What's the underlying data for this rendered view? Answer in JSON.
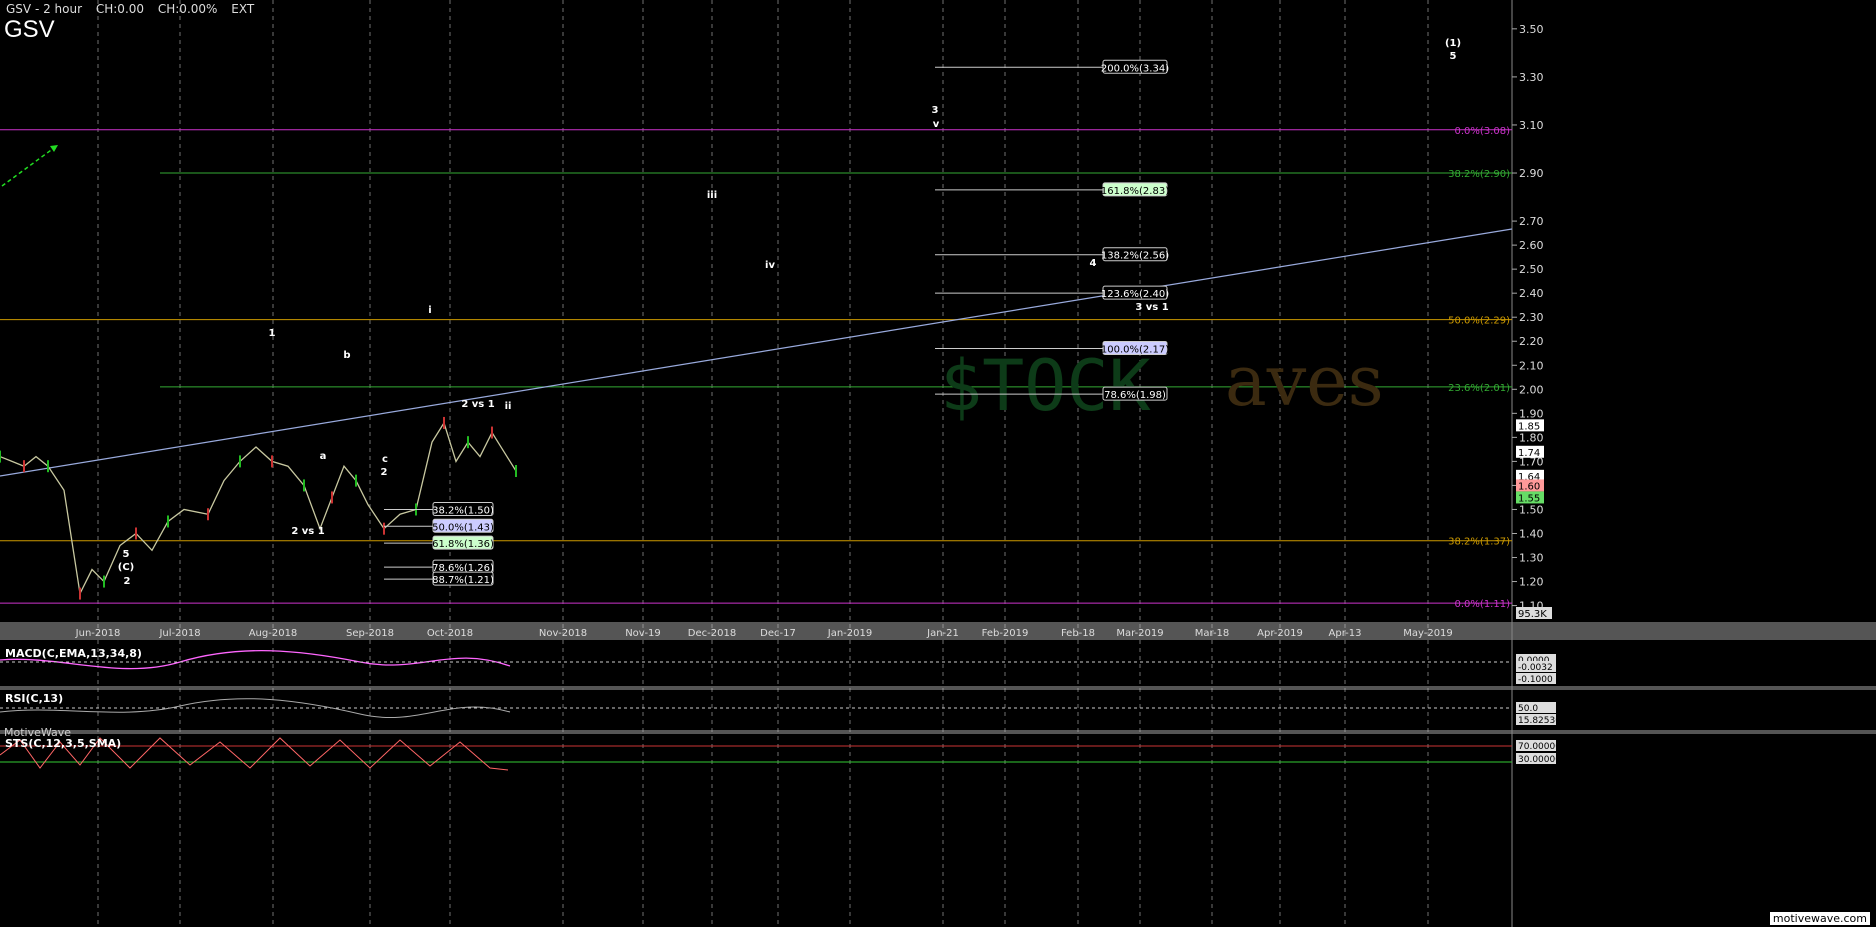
{
  "header": {
    "title": "GSV - 2 hour",
    "ch": "CH:0.00",
    "chp": "CH:0.00%",
    "ext": "EXT",
    "symbol": "GSV"
  },
  "watermark": "MotiveWave",
  "watermark_bottom": "motivewave.com",
  "brand_text": "$TOCK",
  "brand_text2": "aves",
  "chart_data": [
    {
      "type": "line",
      "title": "GSV - 2 hour",
      "ylim": [
        1.04,
        3.62
      ],
      "yticks": [
        3.5,
        3.3,
        3.1,
        2.9,
        2.7,
        2.6,
        2.5,
        2.4,
        2.3,
        2.2,
        2.1,
        2.0,
        1.9,
        1.8,
        1.7,
        1.6,
        1.5,
        1.4,
        1.3,
        1.2,
        1.1
      ],
      "xticks": [
        "Jun-2018",
        "Jul-2018",
        "Aug-2018",
        "Sep-2018",
        "Oct-2018",
        "Nov-2018",
        "Nov-19",
        "Dec-2018",
        "Dec-17",
        "Jan-2019",
        "Jan-21",
        "Feb-2019",
        "Feb-18",
        "Mar-2019",
        "Mar-18",
        "Apr-2019",
        "Apr-13",
        "May-2019"
      ],
      "price_path": [
        [
          0,
          1.72
        ],
        [
          0.15,
          1.7
        ],
        [
          0.3,
          1.68
        ],
        [
          0.45,
          1.72
        ],
        [
          0.6,
          1.68
        ],
        [
          0.8,
          1.58
        ],
        [
          1.0,
          1.15
        ],
        [
          1.15,
          1.25
        ],
        [
          1.3,
          1.2
        ],
        [
          1.5,
          1.35
        ],
        [
          1.7,
          1.4
        ],
        [
          1.9,
          1.33
        ],
        [
          2.1,
          1.45
        ],
        [
          2.3,
          1.5
        ],
        [
          2.6,
          1.48
        ],
        [
          2.8,
          1.62
        ],
        [
          3.0,
          1.7
        ],
        [
          3.2,
          1.76
        ],
        [
          3.4,
          1.7
        ],
        [
          3.6,
          1.68
        ],
        [
          3.8,
          1.6
        ],
        [
          4.0,
          1.42
        ],
        [
          4.15,
          1.55
        ],
        [
          4.3,
          1.68
        ],
        [
          4.45,
          1.62
        ],
        [
          4.6,
          1.52
        ],
        [
          4.8,
          1.42
        ],
        [
          5.0,
          1.48
        ],
        [
          5.2,
          1.5
        ],
        [
          5.4,
          1.78
        ],
        [
          5.55,
          1.86
        ],
        [
          5.7,
          1.7
        ],
        [
          5.85,
          1.78
        ],
        [
          6.0,
          1.72
        ],
        [
          6.15,
          1.82
        ],
        [
          6.3,
          1.74
        ],
        [
          6.45,
          1.66
        ]
      ],
      "fib_levels_up": [
        {
          "label": "200.0%(3.34)",
          "value": 3.34
        },
        {
          "label": "161.8%(2.83)",
          "value": 2.83,
          "color": "#ccffcc"
        },
        {
          "label": "138.2%(2.56)",
          "value": 2.56
        },
        {
          "label": "123.6%(2.40)",
          "value": 2.4
        },
        {
          "label": "100.0%(2.17)",
          "value": 2.17,
          "color": "#ccccff"
        },
        {
          "label": "78.6%(1.98)",
          "value": 1.98
        }
      ],
      "fib_levels_down": [
        {
          "label": "38.2%(1.50)",
          "value": 1.5
        },
        {
          "label": "50.0%(1.43)",
          "value": 1.43,
          "color": "#ccccff"
        },
        {
          "label": "61.8%(1.36)",
          "value": 1.36,
          "color": "#ccffcc"
        },
        {
          "label": "78.6%(1.26)",
          "value": 1.26
        },
        {
          "label": "88.7%(1.21)",
          "value": 1.21
        }
      ],
      "horizontal_lines": [
        {
          "label": "0.0%(3.08)",
          "value": 3.08,
          "color": "#cc33cc"
        },
        {
          "label": "38.2%(2.90)",
          "value": 2.9,
          "color": "#33aa33"
        },
        {
          "label": "50.0%(2.29)",
          "value": 2.29,
          "color": "#cc9900"
        },
        {
          "label": "23.6%(2.01)",
          "value": 2.01,
          "color": "#33aa33"
        },
        {
          "label": "38.2%(1.37)",
          "value": 1.37,
          "color": "#cc9900"
        },
        {
          "label": "0.0%(1.11)",
          "value": 1.11,
          "color": "#cc33cc"
        }
      ],
      "price_tags": [
        {
          "label": "1.85",
          "value": 1.85,
          "bg": "#ffffff",
          "fg": "#000"
        },
        {
          "label": "1.74",
          "value": 1.74,
          "bg": "#ffffff",
          "fg": "#000"
        },
        {
          "label": "1.64",
          "value": 1.64,
          "bg": "#ffffff",
          "fg": "#000"
        },
        {
          "label": "1.60",
          "value": 1.6,
          "bg": "#ff9999",
          "fg": "#000"
        },
        {
          "label": "1.55",
          "value": 1.55,
          "bg": "#66dd66",
          "fg": "#000"
        }
      ],
      "volume_tag": "95.3K",
      "wave_labels": [
        "(1)",
        "5",
        "3",
        "v",
        "iii",
        "iv",
        "4",
        "3 vs 1",
        "1",
        "b",
        "i",
        "2 vs 1",
        "ii",
        "a",
        "c",
        "2",
        "5",
        "(C)",
        "2",
        "2 vs 1"
      ]
    },
    {
      "type": "line",
      "title": "MACD(C,EMA,13,34,8)",
      "tags": [
        "0.0000",
        "-0.0032",
        "-0.1000"
      ]
    },
    {
      "type": "line",
      "title": "RSI(C,13)",
      "tags": [
        "50.0",
        "15.82530"
      ]
    },
    {
      "type": "line",
      "title": "STS(C,12,3,5,SMA)",
      "tags": [
        "70.00000",
        "30.00000"
      ]
    }
  ]
}
